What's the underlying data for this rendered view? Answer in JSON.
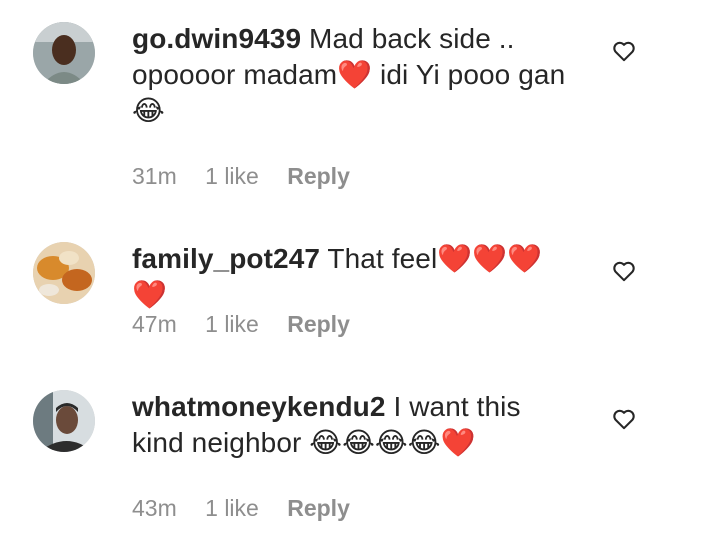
{
  "comments": [
    {
      "username": "go.dwin9439",
      "text": "Mad back side .. opoooor madam❤️ idi Yi pooo gan😂",
      "time": "31m",
      "likes": "1 like",
      "reply": "Reply"
    },
    {
      "username": "family_pot247",
      "text": "That feel❤️❤️❤️❤️",
      "time": "47m",
      "likes": "1 like",
      "reply": "Reply"
    },
    {
      "username": "whatmoneykendu2",
      "text": "I want this kind neighbor 😂😂😂😂❤️",
      "time": "43m",
      "likes": "1 like",
      "reply": "Reply"
    }
  ],
  "icons": {
    "like": "heart-outline-icon"
  },
  "colors": {
    "meta": "#8e8e8e",
    "text": "#262626"
  }
}
